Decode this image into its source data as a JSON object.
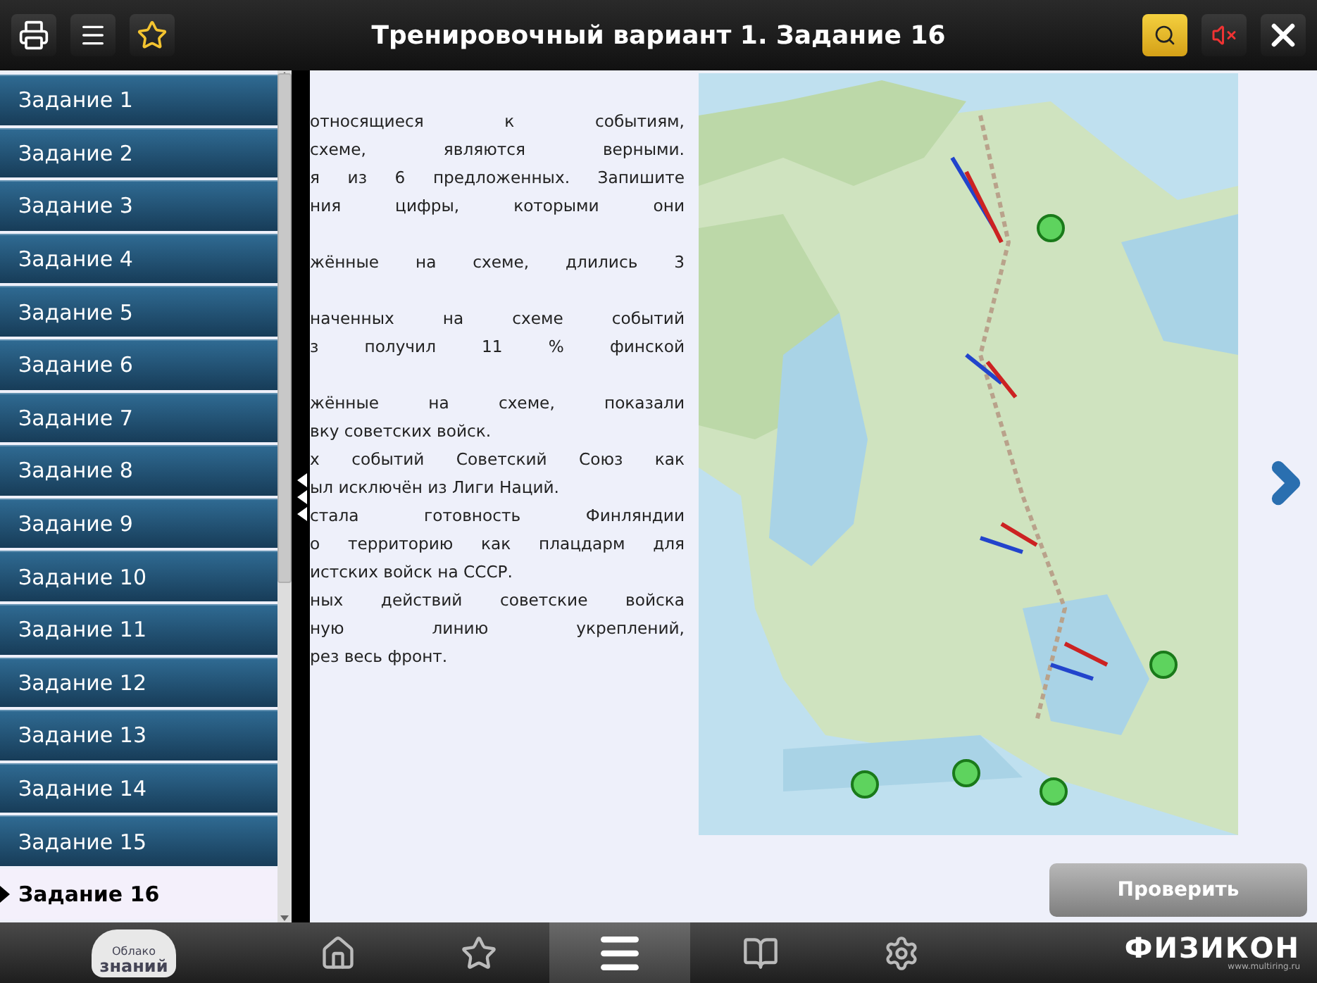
{
  "toolbar": {
    "title": "Тренировочный вариант 1. Задание 16",
    "sound_muted": true
  },
  "sidebar": {
    "items": [
      {
        "label": "Задание 1",
        "selected": false
      },
      {
        "label": "Задание 2",
        "selected": false
      },
      {
        "label": "Задание 3",
        "selected": false
      },
      {
        "label": "Задание 4",
        "selected": false
      },
      {
        "label": "Задание 5",
        "selected": false
      },
      {
        "label": "Задание 6",
        "selected": false
      },
      {
        "label": "Задание 7",
        "selected": false
      },
      {
        "label": "Задание 8",
        "selected": false
      },
      {
        "label": "Задание 9",
        "selected": false
      },
      {
        "label": "Задание 10",
        "selected": false
      },
      {
        "label": "Задание 11",
        "selected": false
      },
      {
        "label": "Задание 12",
        "selected": false
      },
      {
        "label": "Задание 13",
        "selected": false
      },
      {
        "label": "Задание 14",
        "selected": false
      },
      {
        "label": "Задание 15",
        "selected": false
      },
      {
        "label": "Задание 16",
        "selected": true
      }
    ]
  },
  "task": {
    "blocks": [
      [
        {
          "lines": [
            "относящиеся к событиям,",
            "схеме, являются верными.",
            "я из 6 предложенных. Запишите",
            "ния цифры, которыми они"
          ]
        }
      ],
      [
        {
          "lines": [
            "жённые на схеме, длились 3"
          ]
        }
      ],
      [
        {
          "lines": [
            "наченных на схеме событий",
            "з получил 11 % финской"
          ]
        }
      ],
      [
        {
          "lines": [
            "жённые на схеме, показали",
            "вку советских войск."
          ]
        },
        {
          "lines": [
            "х событий Советский Союз как",
            "ыл исключён из Лиги Наций."
          ]
        },
        {
          "lines": [
            "стала готовность Финляндии",
            "о территорию как плацдарм для",
            "истских войск на СССР."
          ]
        },
        {
          "lines": [
            "ных действий советские войска",
            "ную линию укреплений,",
            "рез весь фронт."
          ]
        }
      ]
    ],
    "map": {
      "kind": "picture"
    },
    "check_button": "Проверить"
  },
  "bottom_bar": {
    "logo_lines": [
      "Облако",
      "знаний"
    ],
    "nav": [
      {
        "kind": "home",
        "selected": false
      },
      {
        "kind": "star",
        "selected": false
      },
      {
        "kind": "menu",
        "selected": true
      },
      {
        "kind": "book",
        "selected": false
      },
      {
        "kind": "gear",
        "selected": false
      }
    ],
    "brand": "ФИЗИКОН",
    "brand_site": "www.multiring.ru"
  }
}
